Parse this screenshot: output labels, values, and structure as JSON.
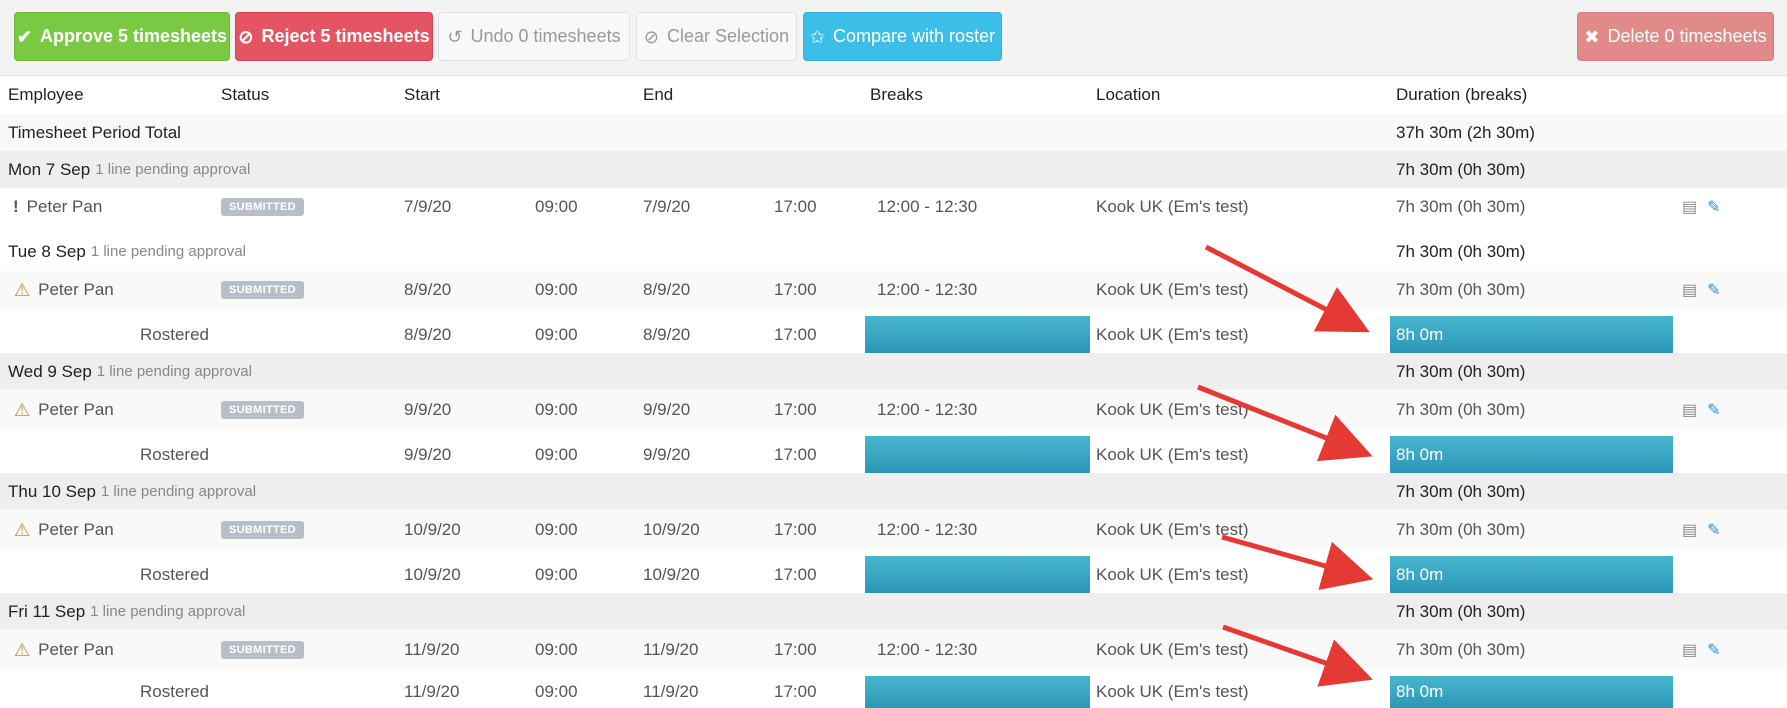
{
  "toolbar": {
    "approve": "Approve 5 timesheets",
    "reject": "Reject 5 timesheets",
    "undo": "Undo 0 timesheets",
    "clear": "Clear Selection",
    "compare": "Compare with roster",
    "delete": "Delete 0 timesheets"
  },
  "headers": {
    "employee": "Employee",
    "status": "Status",
    "start": "Start",
    "end": "End",
    "breaks": "Breaks",
    "location": "Location",
    "duration": "Duration (breaks)"
  },
  "period_total": {
    "label": "Timesheet Period Total",
    "value": "37h 30m (2h 30m)"
  },
  "days": [
    {
      "label": "Mon 7 Sep",
      "pending": "1 line pending approval",
      "total": "7h 30m (0h 30m)",
      "entry": {
        "employee": "Peter Pan",
        "status": "SUBMITTED",
        "start_date": "7/9/20",
        "start_time": "09:00",
        "end_date": "7/9/20",
        "end_time": "17:00",
        "breaks": "12:00 - 12:30",
        "location": "Kook UK (Em's test)",
        "duration": "7h 30m (0h 30m)"
      }
    },
    {
      "label": "Tue 8 Sep",
      "pending": "1 line pending approval",
      "total": "7h 30m (0h 30m)",
      "entry": {
        "employee": "Peter Pan",
        "status": "SUBMITTED",
        "start_date": "8/9/20",
        "start_time": "09:00",
        "end_date": "8/9/20",
        "end_time": "17:00",
        "breaks": "12:00 - 12:30",
        "location": "Kook UK (Em's test)",
        "duration": "7h 30m (0h 30m)"
      },
      "rostered": {
        "label": "Rostered",
        "start_date": "8/9/20",
        "start_time": "09:00",
        "end_date": "8/9/20",
        "end_time": "17:00",
        "location": "Kook UK (Em's test)",
        "duration": "8h 0m"
      }
    },
    {
      "label": "Wed 9 Sep",
      "pending": "1 line pending approval",
      "total": "7h 30m (0h 30m)",
      "entry": {
        "employee": "Peter Pan",
        "status": "SUBMITTED",
        "start_date": "9/9/20",
        "start_time": "09:00",
        "end_date": "9/9/20",
        "end_time": "17:00",
        "breaks": "12:00 - 12:30",
        "location": "Kook UK (Em's test)",
        "duration": "7h 30m (0h 30m)"
      },
      "rostered": {
        "label": "Rostered",
        "start_date": "9/9/20",
        "start_time": "09:00",
        "end_date": "9/9/20",
        "end_time": "17:00",
        "location": "Kook UK (Em's test)",
        "duration": "8h 0m"
      }
    },
    {
      "label": "Thu 10 Sep",
      "pending": "1 line pending approval",
      "total": "7h 30m (0h 30m)",
      "entry": {
        "employee": "Peter Pan",
        "status": "SUBMITTED",
        "start_date": "10/9/20",
        "start_time": "09:00",
        "end_date": "10/9/20",
        "end_time": "17:00",
        "breaks": "12:00 - 12:30",
        "location": "Kook UK (Em's test)",
        "duration": "7h 30m (0h 30m)"
      },
      "rostered": {
        "label": "Rostered",
        "start_date": "10/9/20",
        "start_time": "09:00",
        "end_date": "10/9/20",
        "end_time": "17:00",
        "location": "Kook UK (Em's test)",
        "duration": "8h 0m"
      }
    },
    {
      "label": "Fri 11 Sep",
      "pending": "1 line pending approval",
      "total": "7h 30m (0h 30m)",
      "entry": {
        "employee": "Peter Pan",
        "status": "SUBMITTED",
        "start_date": "11/9/20",
        "start_time": "09:00",
        "end_date": "11/9/20",
        "end_time": "17:00",
        "breaks": "12:00 - 12:30",
        "location": "Kook UK (Em's test)",
        "duration": "7h 30m (0h 30m)"
      },
      "rostered": {
        "label": "Rostered",
        "start_date": "11/9/20",
        "start_time": "09:00",
        "end_date": "11/9/20",
        "end_time": "17:00",
        "location": "Kook UK (Em's test)",
        "duration": "8h 0m"
      }
    }
  ],
  "colors": {
    "approve": "#7ac943",
    "reject": "#e55463",
    "compare": "#3bbfe8",
    "delete": "#e08a8a",
    "rostered_bar": "#3aa7c4",
    "arrow": "#e53935"
  },
  "icons": {
    "approve": "check-circle-icon",
    "reject": "ban-icon",
    "undo": "undo-icon",
    "clear": "ban-icon",
    "compare": "star-icon",
    "delete": "times-circle-icon"
  }
}
